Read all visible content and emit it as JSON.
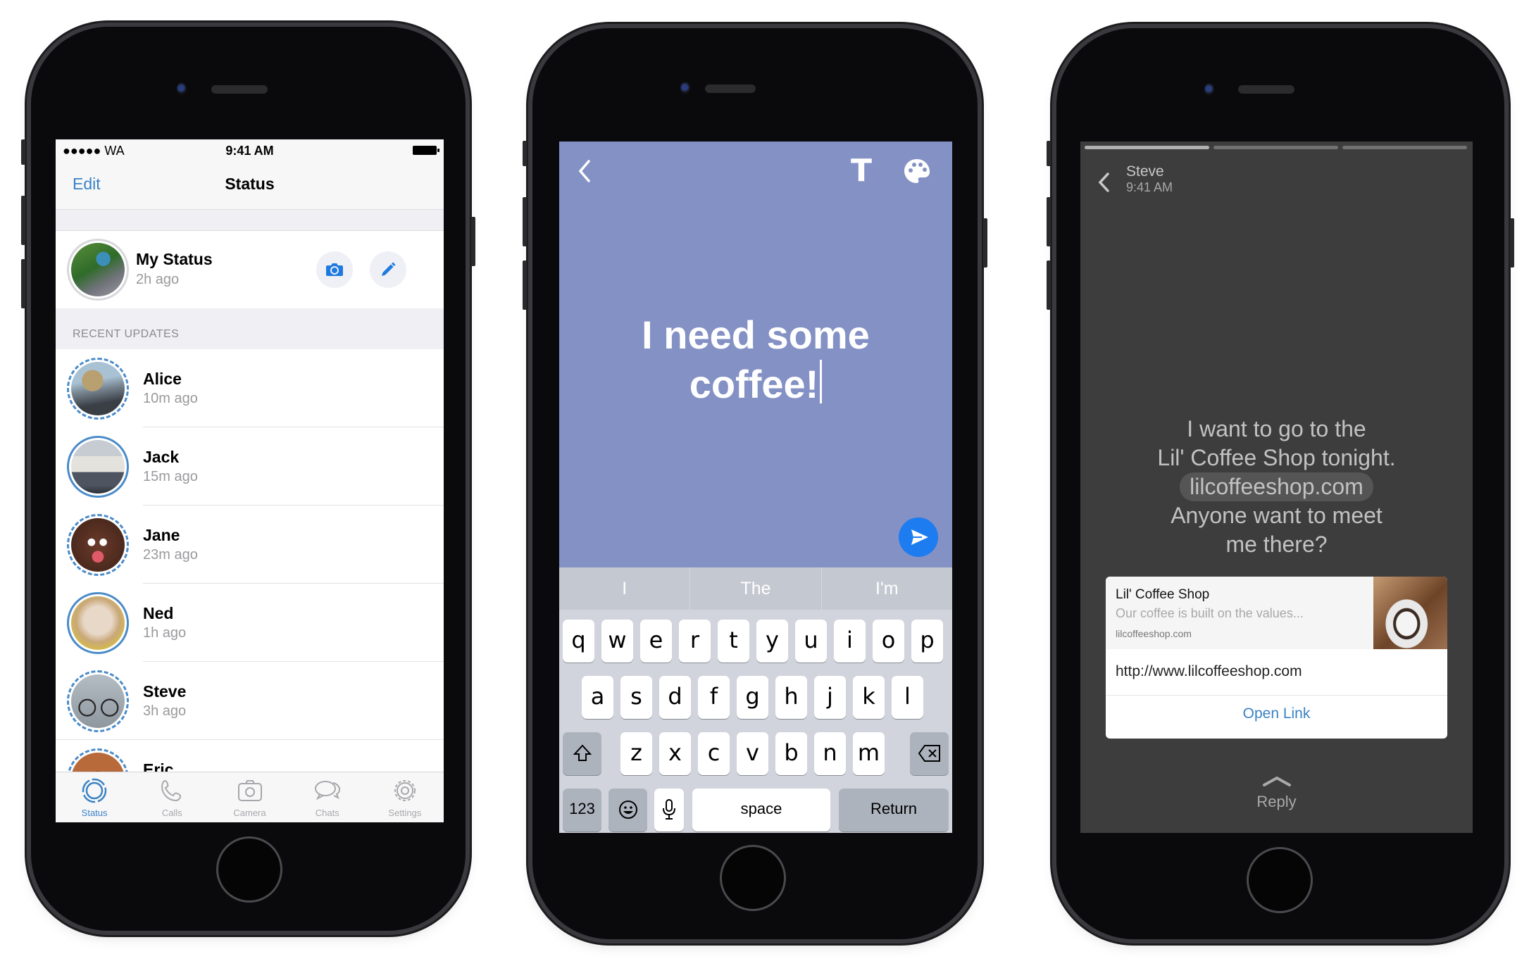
{
  "phone1": {
    "statusbar": {
      "carrier": "●●●●● WA",
      "time": "9:41 AM",
      "battery_icon": "battery-full-icon"
    },
    "navbar": {
      "edit_label": "Edit",
      "title": "Status"
    },
    "my_status": {
      "name": "My Status",
      "time": "2h ago",
      "camera_icon": "camera-icon",
      "pencil_icon": "pencil-icon"
    },
    "section_header": "RECENT UPDATES",
    "updates": [
      {
        "name": "Alice",
        "time": "10m ago"
      },
      {
        "name": "Jack",
        "time": "15m ago"
      },
      {
        "name": "Jane",
        "time": "23m ago"
      },
      {
        "name": "Ned",
        "time": "1h ago"
      },
      {
        "name": "Steve",
        "time": "3h ago"
      },
      {
        "name": "Eric",
        "time": ""
      }
    ],
    "tabs": [
      {
        "label": "Status",
        "icon": "status-ring-icon",
        "active": true
      },
      {
        "label": "Calls",
        "icon": "phone-icon",
        "active": false
      },
      {
        "label": "Camera",
        "icon": "camera-icon",
        "active": false
      },
      {
        "label": "Chats",
        "icon": "chat-bubbles-icon",
        "active": false
      },
      {
        "label": "Settings",
        "icon": "gear-icon",
        "active": false
      }
    ]
  },
  "phone2": {
    "back_icon": "chevron-left-icon",
    "text_tool_label": "T",
    "palette_icon": "palette-icon",
    "compose_text_line1": "I need some",
    "compose_text_line2": "coffee!",
    "background_color": "#8491c4",
    "send_icon": "send-icon",
    "suggestions": [
      "I",
      "The",
      "I'm"
    ],
    "keyboard": {
      "row1": [
        "q",
        "w",
        "e",
        "r",
        "t",
        "y",
        "u",
        "i",
        "o",
        "p"
      ],
      "row2": [
        "a",
        "s",
        "d",
        "f",
        "g",
        "h",
        "j",
        "k",
        "l"
      ],
      "row3": [
        "z",
        "x",
        "c",
        "v",
        "b",
        "n",
        "m"
      ],
      "shift_icon": "shift-icon",
      "delete_icon": "backspace-icon",
      "numbers_label": "123",
      "emoji_icon": "emoji-icon",
      "mic_icon": "microphone-icon",
      "space_label": "space",
      "return_label": "Return"
    }
  },
  "phone3": {
    "progress_segments": [
      1,
      0,
      0
    ],
    "back_icon": "chevron-left-icon",
    "sender": "Steve",
    "time": "9:41 AM",
    "message_line1": "I want to go to the",
    "message_line2": "Lil' Coffee Shop tonight.",
    "message_link": "lilcoffeeshop.com",
    "message_line4": "Anyone want to meet",
    "message_line5": "me there?",
    "link_card": {
      "title": "Lil' Coffee Shop",
      "description": "Our coffee is built on the values...",
      "domain": "lilcoffeeshop.com",
      "url": "http://www.lilcoffeeshop.com",
      "open_label": "Open Link"
    },
    "reply_icon": "chevron-up-icon",
    "reply_label": "Reply"
  },
  "colors": {
    "accent_blue": "#3b82c4",
    "send_blue": "#1c7cf0",
    "viewer_bg": "#3d3d3d"
  }
}
